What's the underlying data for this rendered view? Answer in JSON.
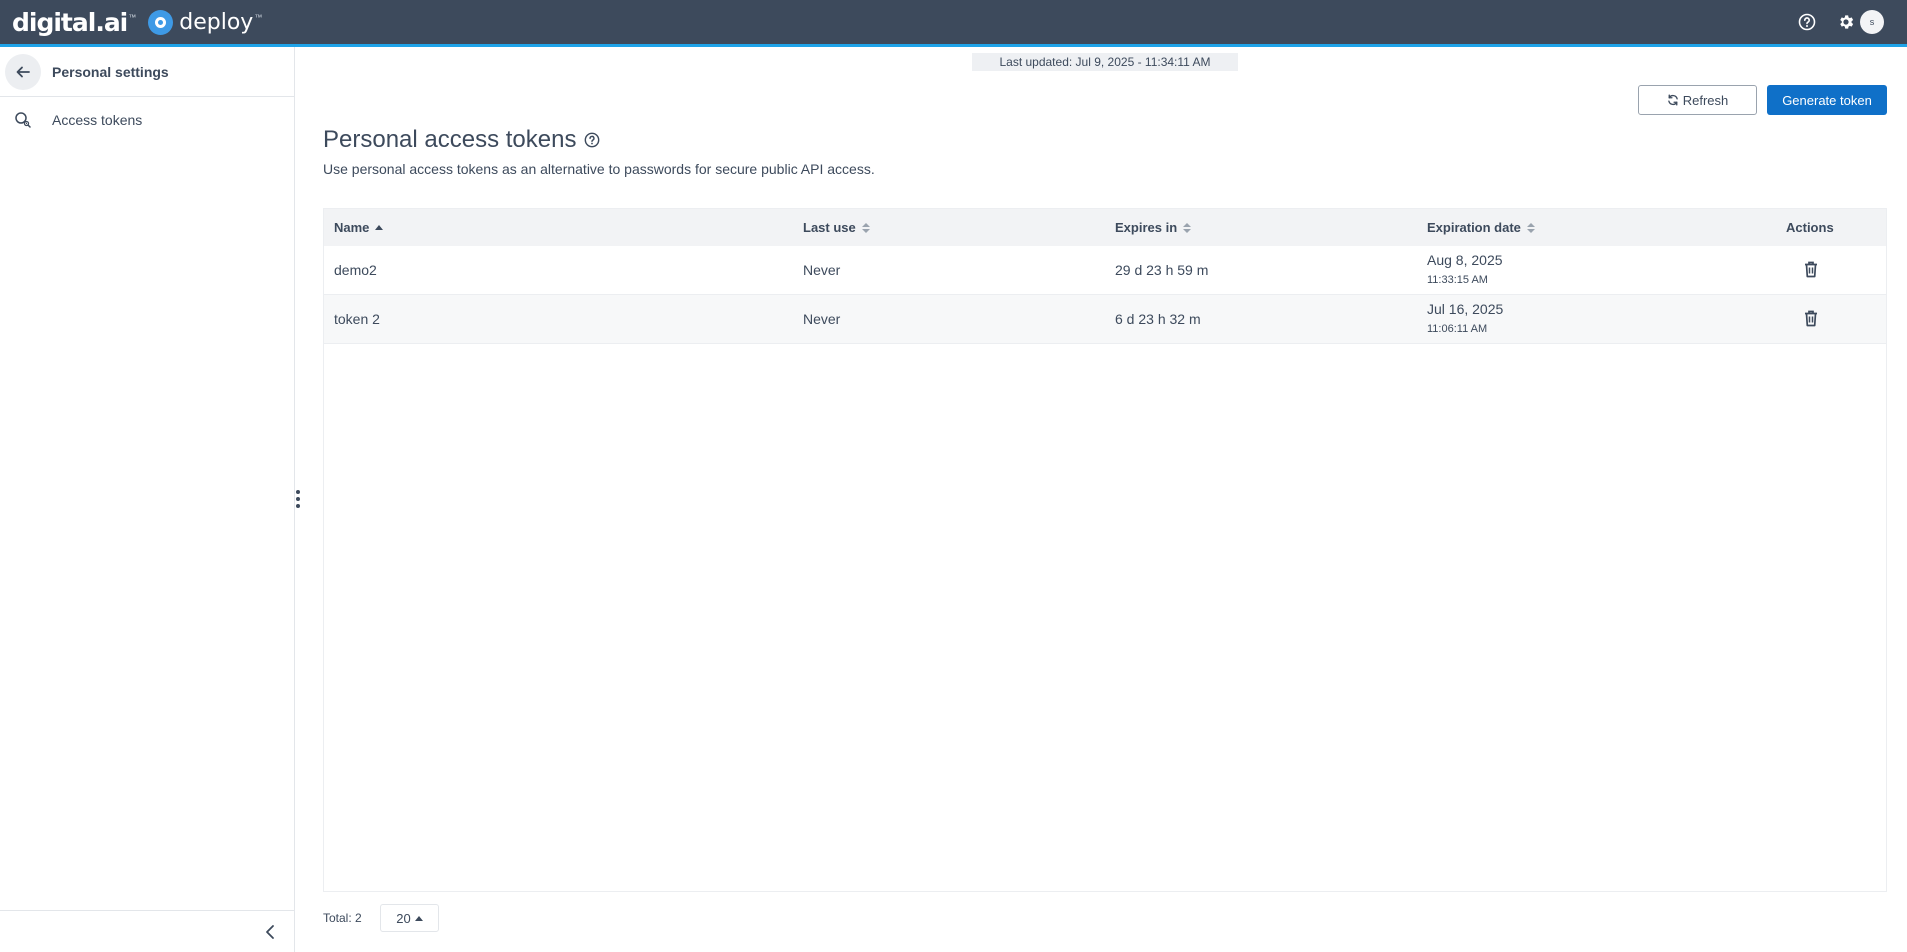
{
  "header": {
    "brand": "digital.ai",
    "brand_tm": "™",
    "product": "deploy",
    "product_tm": "™",
    "avatar_initial": "s",
    "icons": [
      "help-icon",
      "gear-icon"
    ]
  },
  "sidebar": {
    "title": "Personal settings",
    "items": [
      {
        "label": "Access tokens",
        "icon": "token-search-icon"
      }
    ]
  },
  "main": {
    "last_updated": "Last updated: Jul 9, 2025 - 11:34:11 AM",
    "refresh_label": "Refresh",
    "generate_label": "Generate token",
    "title": "Personal access tokens",
    "description": "Use personal access tokens as an alternative to passwords for secure public API access.",
    "table": {
      "columns": [
        "Name",
        "Last use",
        "Expires in",
        "Expiration date",
        "Actions"
      ],
      "rows": [
        {
          "name": "demo2",
          "last_use": "Never",
          "expires_in": "29 d 23 h 59 m",
          "expiration_date": "Aug 8, 2025",
          "expiration_time": "11:33:15 AM"
        },
        {
          "name": "token 2",
          "last_use": "Never",
          "expires_in": "6 d 23 h 32 m",
          "expiration_date": "Jul 16, 2025",
          "expiration_time": "11:06:11 AM"
        }
      ]
    },
    "total": "Total: 2",
    "page_size": "20"
  },
  "colors": {
    "topbar": "#3d4a5c",
    "accent": "#1fa3e8",
    "primary_button": "#0f70c8",
    "text": "#3d4a5c"
  }
}
